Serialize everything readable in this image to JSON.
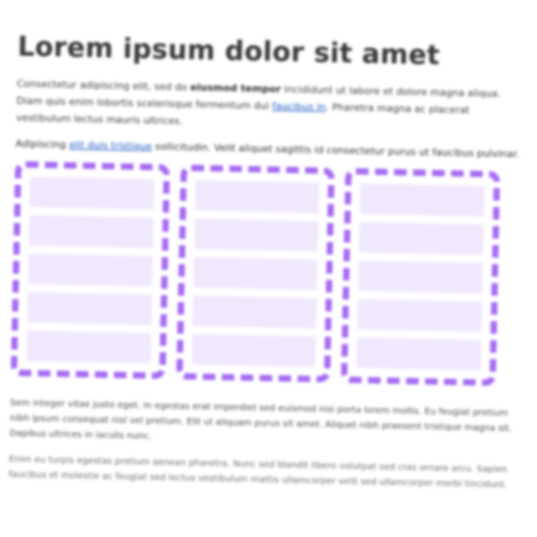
{
  "article": {
    "title": "Lorem ipsum dolor sit amet",
    "intro": {
      "text_before": "Consectetur adipiscing elit, sed do ",
      "bold": "eiusmod tempor",
      "text_middle": " incididunt ut labore et dolore magna aliqua. Diam quis enim lobortis scelerisque fermentum dui ",
      "link": "faucibus in",
      "text_after": ". Pharetra magna ac placerat vestibulum lectus mauris ultrices."
    },
    "second": {
      "text_before": "Adipiscing ",
      "link": "elit duis tristique",
      "text_after": " sollicitudin. Velit aliquet sagittis id consectetur purus ut faucibus pulvinar."
    },
    "footer_para_1": "Sem integer vitae justo eget. In egestas erat imperdiet sed euismod nisi porta lorem mollis. Eu feugiat pretium nibh ipsum consequat nisl vel pretium. Elit ut aliquam purus sit amet. Aliquet nibh praesent tristique magna sit. Dapibus ultrices in iaculis nunc.",
    "footer_para_2": "Enim eu turpis egestas pretium aenean pharetra. Nunc sed blandit libero volutpat sed cras ornare arcu. Sapien faucibus et molestie ac feugiat sed lectus vestibulum mattis ullamcorper velit sed ullamcorper morbi tincidunt."
  },
  "layout_preview": {
    "accent_color": "#a56af2",
    "placeholder_color": "#f0e8fd",
    "columns": [
      {
        "slots": 5
      },
      {
        "slots": 5
      },
      {
        "slots": 5
      }
    ]
  }
}
